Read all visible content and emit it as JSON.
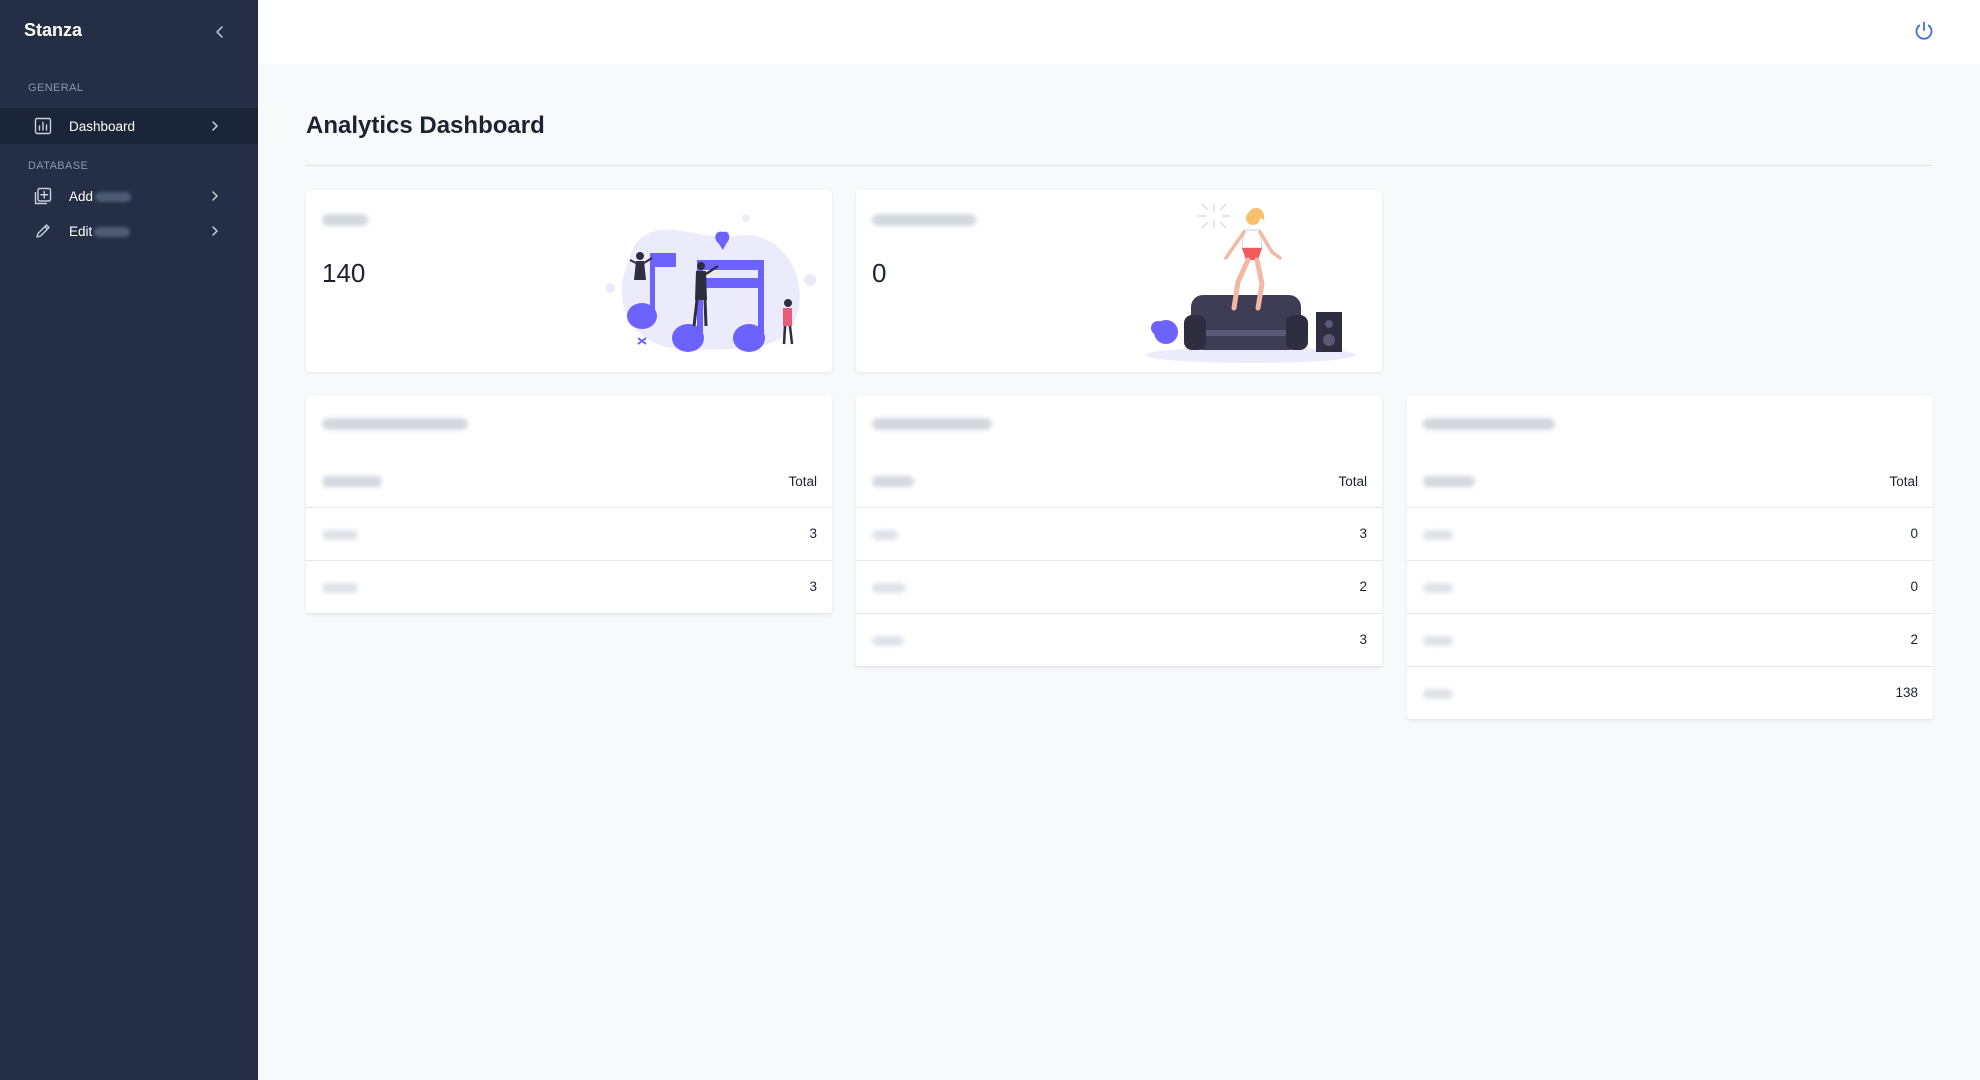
{
  "sidebar": {
    "brand": "Stanza",
    "sections": {
      "general": "GENERAL",
      "database": "DATABASE"
    },
    "items": [
      {
        "label": "Dashboard",
        "icon": "chart-icon"
      },
      {
        "label": "Add",
        "icon": "add-box-icon"
      },
      {
        "label": "Edit",
        "icon": "pencil-icon"
      }
    ]
  },
  "topbar": {
    "icon": "power-icon"
  },
  "page": {
    "title": "Analytics Dashboard"
  },
  "stats": [
    {
      "value": "140"
    },
    {
      "value": "0"
    }
  ],
  "tables": [
    {
      "total_header": "Total",
      "rows": [
        {
          "value": "3"
        },
        {
          "value": "3"
        }
      ]
    },
    {
      "total_header": "Total",
      "rows": [
        {
          "value": "3"
        },
        {
          "value": "2"
        },
        {
          "value": "3"
        }
      ]
    },
    {
      "total_header": "Total",
      "rows": [
        {
          "value": "0"
        },
        {
          "value": "0"
        },
        {
          "value": "2"
        },
        {
          "value": "138"
        }
      ]
    }
  ],
  "colors": {
    "sidebar_bg": "#242f45",
    "sidebar_active": "#1b2538",
    "accent": "#3b6fd8",
    "illustration_primary": "#6c63ff"
  }
}
